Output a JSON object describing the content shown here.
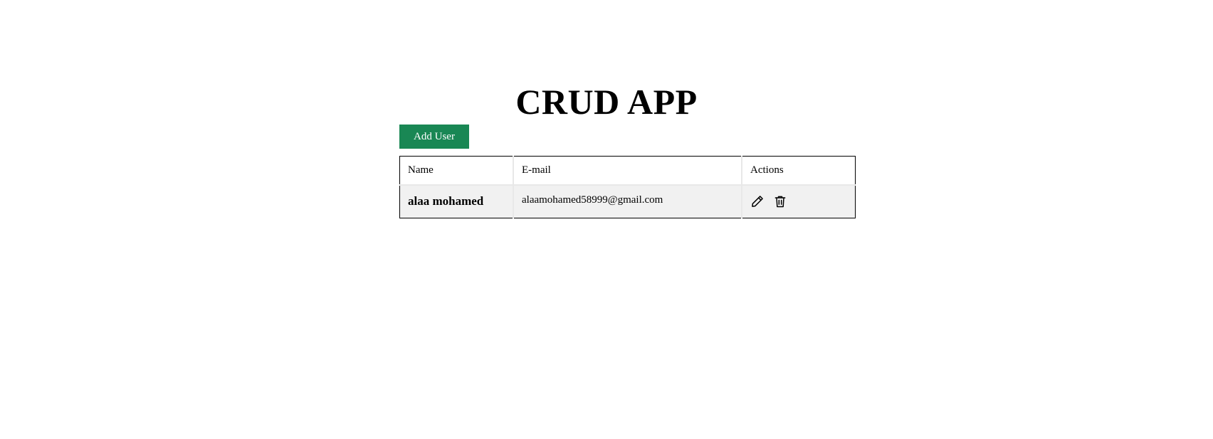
{
  "header": {
    "title": "CRUD APP"
  },
  "toolbar": {
    "add_label": "Add User"
  },
  "table": {
    "columns": [
      "Name",
      "E-mail",
      "Actions"
    ],
    "rows": [
      {
        "name": "alaa mohamed",
        "email": "alaamohamed58999@gmail.com",
        "actions": [
          "pencil-icon",
          "trash-icon"
        ]
      }
    ]
  },
  "colors": {
    "accent": "#198754",
    "row_background": "#f1f1f1",
    "border": "#000000"
  }
}
